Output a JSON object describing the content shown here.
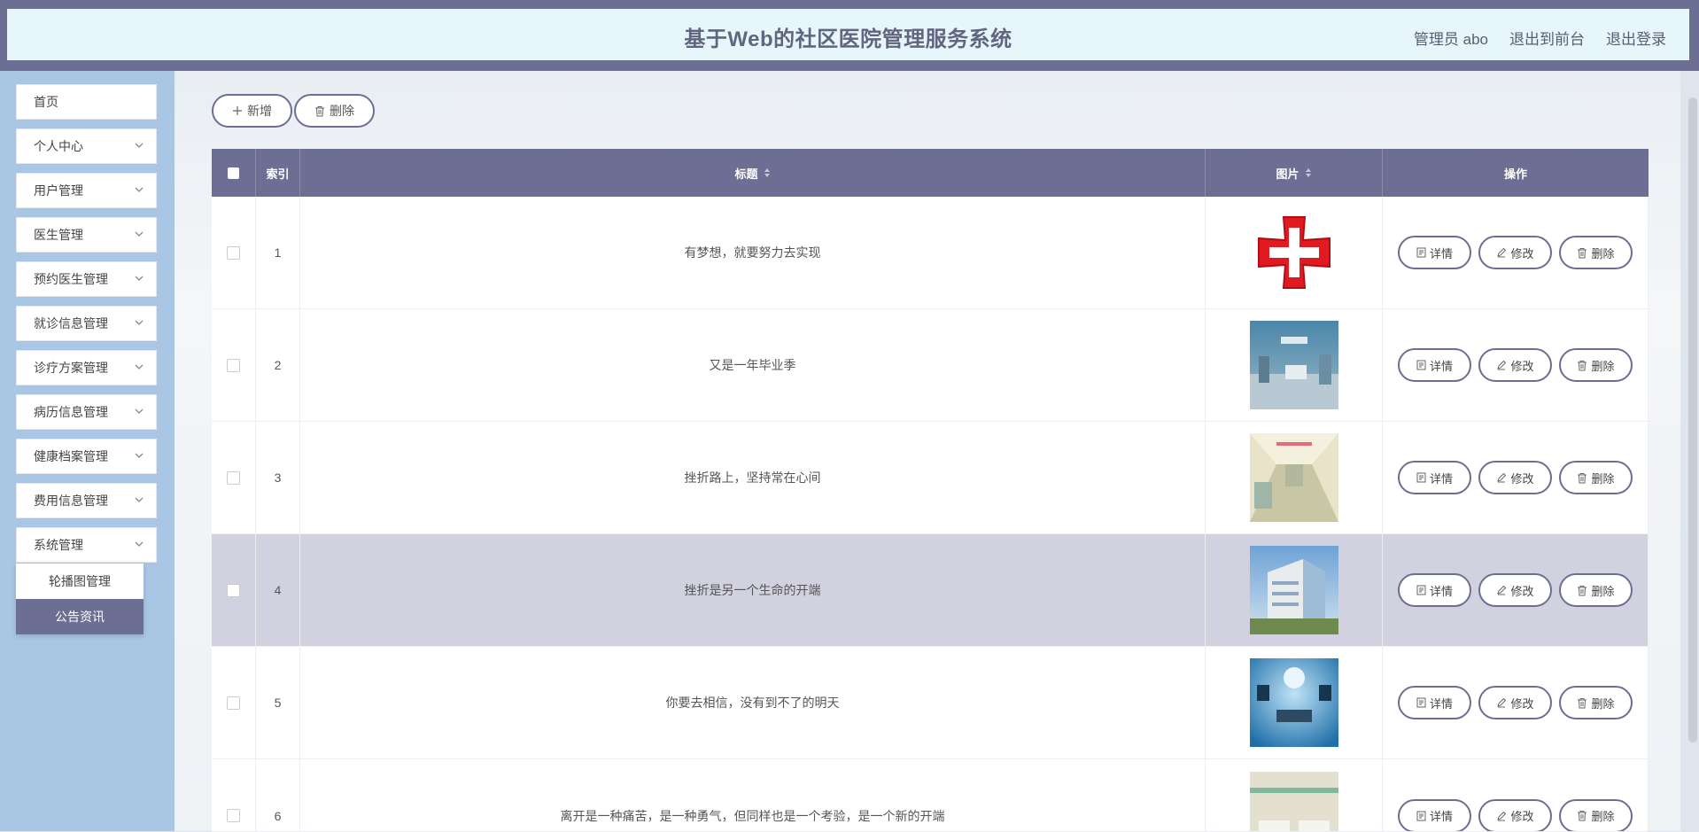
{
  "header": {
    "title": "基于Web的社区医院管理服务系统",
    "user_label": "管理员 abo",
    "to_front_label": "退出到前台",
    "logout_label": "退出登录"
  },
  "sidebar": {
    "items": [
      {
        "label": "首页"
      },
      {
        "label": "个人中心"
      },
      {
        "label": "用户管理"
      },
      {
        "label": "医生管理"
      },
      {
        "label": "预约医生管理"
      },
      {
        "label": "就诊信息管理"
      },
      {
        "label": "诊疗方案管理"
      },
      {
        "label": "病历信息管理"
      },
      {
        "label": "健康档案管理"
      },
      {
        "label": "费用信息管理"
      },
      {
        "label": "系统管理"
      }
    ],
    "submenu": [
      {
        "label": "轮播图管理"
      },
      {
        "label": "公告资讯"
      }
    ]
  },
  "toolbar": {
    "add_label": "新增",
    "delete_label": "删除"
  },
  "table": {
    "columns": {
      "index": "索引",
      "title": "标题",
      "image": "图片",
      "ops": "操作"
    },
    "ops": {
      "detail": "详情",
      "edit": "修改",
      "delete": "删除"
    },
    "rows": [
      {
        "index": "1",
        "title": "有梦想，就要努力去实现",
        "image": "red-cross-logo"
      },
      {
        "index": "2",
        "title": "又是一年毕业季",
        "image": "operating-room-photo"
      },
      {
        "index": "3",
        "title": "挫折路上，坚持常在心间",
        "image": "hospital-corridor-photo"
      },
      {
        "index": "4",
        "title": "挫折是另一个生命的开端",
        "image": "hospital-building-photo"
      },
      {
        "index": "5",
        "title": "你要去相信，没有到不了的明天",
        "image": "surgery-room-photo"
      },
      {
        "index": "6",
        "title": "离开是一种痛苦，是一种勇气，但同样也是一个考验，是一个新的开端",
        "image": "ward-photo"
      }
    ]
  },
  "colors": {
    "accent": "#6d6e93",
    "header_bg": "#e6f6fb",
    "sidebar_bg": "#a9c6e4",
    "highlight_row": "#d1d1e0"
  }
}
